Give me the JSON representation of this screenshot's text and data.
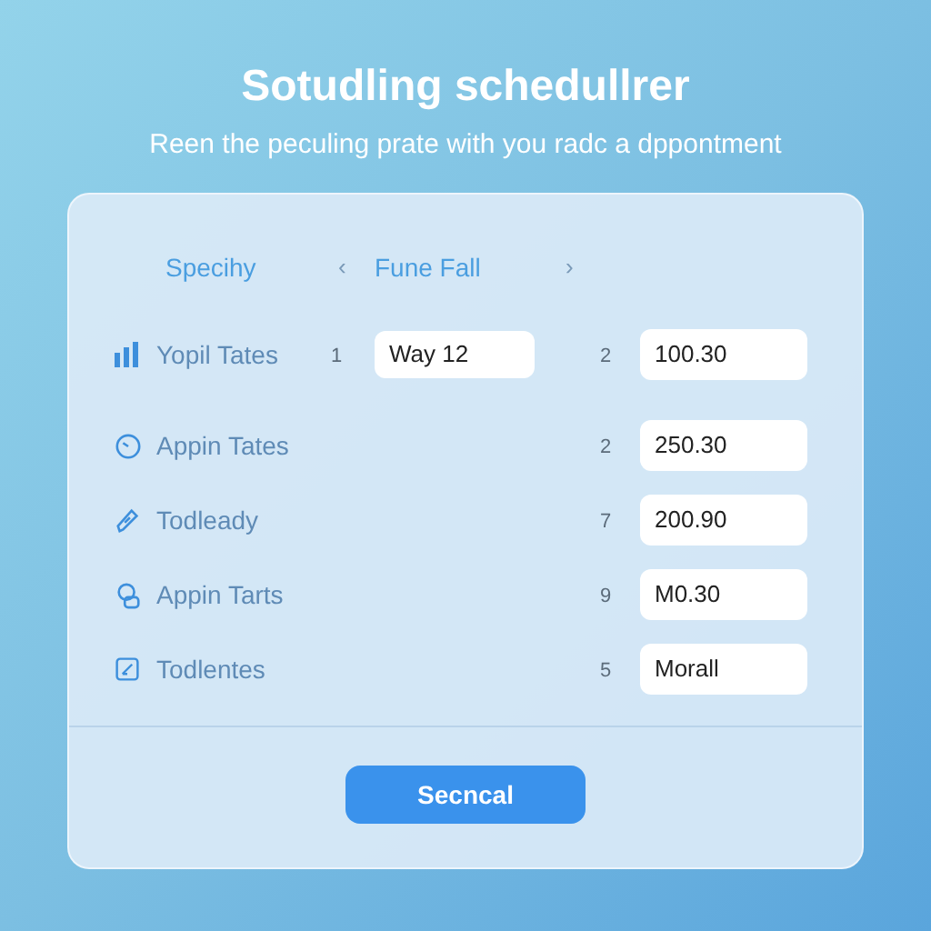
{
  "title": "Sotudling schedullrer",
  "subtitle": "Reen the peculing prate with you radc a dppontment",
  "header": {
    "label": "Specihy",
    "prev": "‹",
    "month": "Fune Fall",
    "next": "›"
  },
  "rows": [
    {
      "label": "Yopil Tates",
      "number_1": "1",
      "field_1": "Way 12",
      "number_2": "2",
      "field_2": "100.30"
    },
    {
      "label": "Appin Tates",
      "number_2": "2",
      "field_2": "250.30"
    },
    {
      "label": "Todleady",
      "number_2": "7",
      "field_2": "200.90"
    },
    {
      "label": "Appin Tarts",
      "number_2": "9",
      "field_2": "M0.30"
    },
    {
      "label": "Todlentes",
      "number_2": "5",
      "field_2": "Morall"
    }
  ],
  "button": "Secncal"
}
